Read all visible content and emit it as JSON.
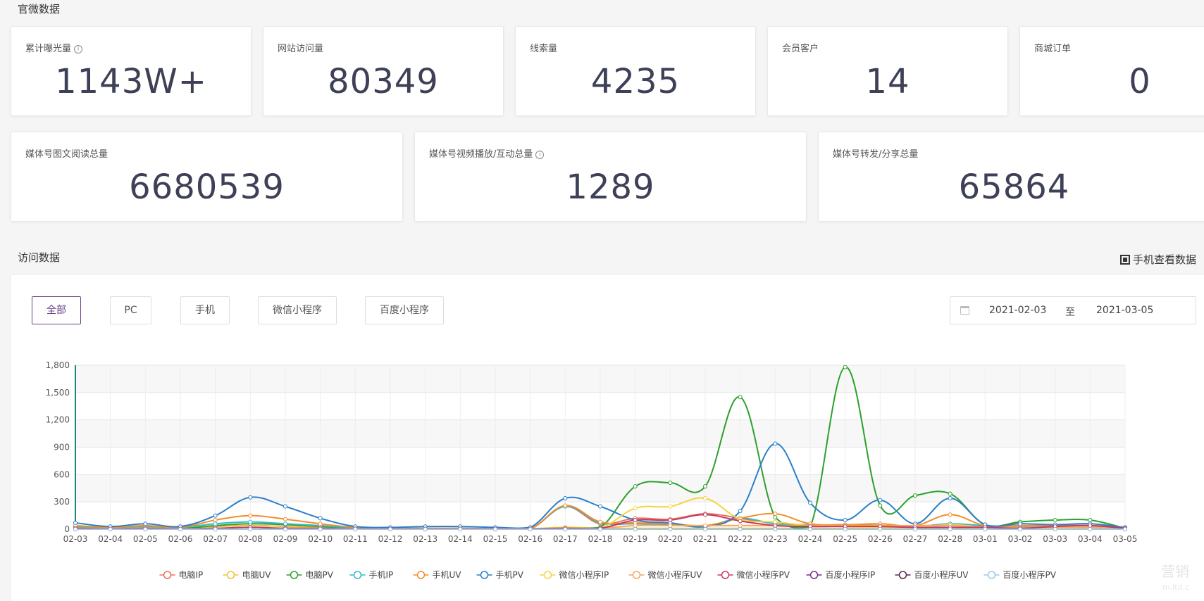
{
  "sections": {
    "official": "官微数据",
    "visits": "访问数据"
  },
  "stats_row1": [
    {
      "label": "累计曝光量",
      "value": "1143W+",
      "info": true
    },
    {
      "label": "网站访问量",
      "value": "80349",
      "info": false
    },
    {
      "label": "线索量",
      "value": "4235",
      "info": false
    },
    {
      "label": "会员客户",
      "value": "14",
      "info": false
    },
    {
      "label": "商城订单",
      "value": "0",
      "info": false
    }
  ],
  "stats_row2": [
    {
      "label": "媒体号图文阅读总量",
      "value": "6680539",
      "info": false
    },
    {
      "label": "媒体号视频播放/互动总量",
      "value": "1289",
      "info": true
    },
    {
      "label": "媒体号转发/分享总量",
      "value": "65864",
      "info": false
    }
  ],
  "mobile_link": "手机查看数据",
  "tabs": [
    "全部",
    "PC",
    "手机",
    "微信小程序",
    "百度小程序"
  ],
  "active_tab": "全部",
  "date_range": {
    "start": "2021-02-03",
    "separator": "至",
    "end": "2021-03-05"
  },
  "watermark": "营销",
  "watermark_small": "m.ltd.c",
  "chart_data": {
    "type": "line",
    "categories": [
      "02-03",
      "02-04",
      "02-05",
      "02-06",
      "02-07",
      "02-08",
      "02-09",
      "02-10",
      "02-11",
      "02-12",
      "02-13",
      "02-14",
      "02-15",
      "02-16",
      "02-17",
      "02-18",
      "02-19",
      "02-20",
      "02-21",
      "02-22",
      "02-23",
      "02-24",
      "02-25",
      "02-26",
      "02-27",
      "02-28",
      "03-01",
      "03-02",
      "03-03",
      "03-04",
      "03-05"
    ],
    "ylim": [
      0,
      1800
    ],
    "yticks": [
      "0",
      "300",
      "600",
      "900",
      "1,200",
      "1,500",
      "1,800"
    ],
    "ytick_values": [
      0,
      300,
      600,
      900,
      1200,
      1500,
      1800
    ],
    "grid": true,
    "legend_position": "bottom",
    "series": [
      {
        "name": "电脑IP",
        "color": "#e8735a",
        "values": [
          20,
          10,
          15,
          10,
          30,
          40,
          30,
          20,
          10,
          5,
          5,
          5,
          5,
          5,
          250,
          60,
          120,
          110,
          170,
          120,
          60,
          40,
          50,
          40,
          30,
          40,
          30,
          20,
          30,
          40,
          20
        ]
      },
      {
        "name": "电脑UV",
        "color": "#f0c33a",
        "values": [
          20,
          10,
          15,
          10,
          30,
          40,
          30,
          20,
          10,
          5,
          5,
          5,
          5,
          5,
          20,
          10,
          10,
          10,
          10,
          10,
          10,
          10,
          10,
          10,
          10,
          10,
          10,
          10,
          10,
          10,
          10
        ]
      },
      {
        "name": "电脑PV",
        "color": "#2ca02c",
        "values": [
          10,
          5,
          10,
          5,
          40,
          60,
          50,
          30,
          10,
          5,
          5,
          5,
          5,
          5,
          10,
          20,
          470,
          510,
          470,
          1450,
          130,
          30,
          1780,
          260,
          370,
          390,
          50,
          80,
          100,
          100,
          10
        ]
      },
      {
        "name": "手机IP",
        "color": "#35b7c9",
        "values": [
          30,
          20,
          30,
          20,
          60,
          80,
          60,
          40,
          15,
          10,
          10,
          10,
          5,
          5,
          250,
          70,
          60,
          50,
          30,
          120,
          60,
          50,
          40,
          40,
          30,
          60,
          40,
          30,
          20,
          20,
          10
        ]
      },
      {
        "name": "手机UV",
        "color": "#f28e2b",
        "values": [
          40,
          20,
          40,
          20,
          100,
          150,
          110,
          60,
          20,
          10,
          10,
          10,
          5,
          5,
          260,
          80,
          70,
          60,
          40,
          120,
          170,
          60,
          50,
          60,
          40,
          160,
          40,
          40,
          40,
          40,
          20
        ]
      },
      {
        "name": "手机PV",
        "color": "#2b7fc9",
        "values": [
          70,
          30,
          60,
          30,
          150,
          350,
          250,
          120,
          30,
          20,
          30,
          30,
          20,
          20,
          340,
          250,
          100,
          70,
          30,
          200,
          940,
          290,
          100,
          320,
          60,
          340,
          50,
          60,
          50,
          60,
          20
        ]
      },
      {
        "name": "微信小程序IP",
        "color": "#f5d440",
        "values": [
          10,
          5,
          10,
          5,
          10,
          20,
          10,
          10,
          5,
          5,
          5,
          5,
          5,
          5,
          10,
          10,
          230,
          250,
          340,
          110,
          80,
          40,
          30,
          20,
          20,
          50,
          20,
          10,
          10,
          20,
          10
        ]
      },
      {
        "name": "微信小程序UV",
        "color": "#f5a760",
        "values": [
          10,
          5,
          10,
          5,
          10,
          20,
          10,
          10,
          5,
          5,
          5,
          5,
          5,
          5,
          10,
          10,
          40,
          40,
          40,
          40,
          40,
          40,
          40,
          40,
          40,
          40,
          20,
          20,
          20,
          20,
          10
        ]
      },
      {
        "name": "微信小程序PV",
        "color": "#c23a6b",
        "values": [
          10,
          5,
          10,
          5,
          10,
          20,
          10,
          10,
          5,
          5,
          5,
          5,
          5,
          5,
          10,
          10,
          100,
          100,
          160,
          90,
          40,
          30,
          30,
          30,
          20,
          20,
          20,
          10,
          30,
          40,
          10
        ]
      },
      {
        "name": "百度小程序IP",
        "color": "#7a2f8c",
        "values": [
          0,
          0,
          0,
          0,
          0,
          0,
          0,
          0,
          0,
          0,
          0,
          0,
          0,
          0,
          0,
          0,
          0,
          0,
          0,
          0,
          0,
          0,
          0,
          0,
          0,
          0,
          0,
          0,
          0,
          0,
          0
        ]
      },
      {
        "name": "百度小程序UV",
        "color": "#5a2750",
        "values": [
          0,
          0,
          0,
          0,
          0,
          0,
          0,
          0,
          0,
          0,
          0,
          0,
          0,
          0,
          0,
          0,
          0,
          0,
          0,
          0,
          0,
          0,
          0,
          0,
          0,
          0,
          0,
          0,
          0,
          0,
          0
        ]
      },
      {
        "name": "百度小程序PV",
        "color": "#9cc9e6",
        "values": [
          0,
          0,
          0,
          0,
          0,
          0,
          0,
          0,
          0,
          0,
          0,
          0,
          0,
          0,
          0,
          0,
          0,
          0,
          0,
          0,
          0,
          0,
          0,
          0,
          0,
          0,
          0,
          0,
          0,
          0,
          0
        ]
      }
    ]
  }
}
